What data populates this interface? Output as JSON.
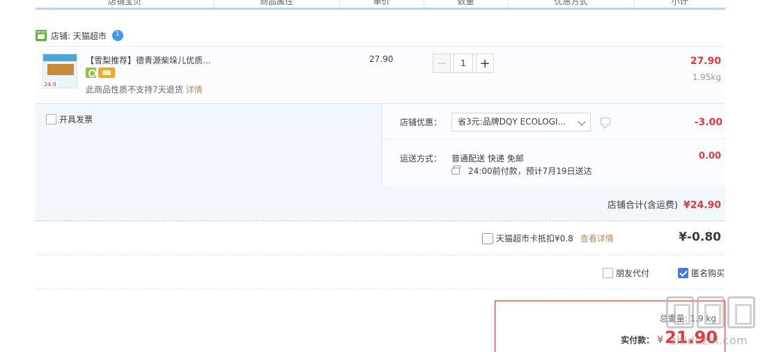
{
  "table_header": {
    "columns": [
      "店铺宝贝",
      "商品属性",
      "单价",
      "数量",
      "优惠方式",
      "小计"
    ]
  },
  "shop": {
    "label": "店铺: 天猫超市"
  },
  "item": {
    "title": "【雪梨推荐】德青源柴垛儿优质...",
    "thumb_tag": "24.9",
    "return_note": "此商品性质不支持7天退货",
    "detail_link": "详情",
    "unit_price": "27.90",
    "quantity": "1",
    "minus_symbol": "−",
    "plus_symbol": "+",
    "subtotal": "27.90",
    "weight": "1.95kg"
  },
  "options": {
    "invoice_label": "开具发票",
    "discount_label": "店铺优惠：",
    "discount_select": "省3元:品牌DQY ECOLOGI...",
    "discount_value": "-3.00",
    "shipping_label": "运送方式：",
    "shipping_method": "普通配送 快递 免邮",
    "shipping_eta": "24:00前付款，预计7月19日送达",
    "shipping_value": "0.00",
    "shop_total_label": "店铺合计(含运费)",
    "shop_total_value": "¥24.90"
  },
  "card": {
    "label": "天猫超市卡抵扣¥0.8",
    "link": "查看详情",
    "value": "¥-0.80"
  },
  "anon": {
    "friend_pay": "朋友代付",
    "anonymous": "匿名购买"
  },
  "pay": {
    "total_text": "总重量: 1.9 kg",
    "actual_label": "实付款：",
    "yen": "¥",
    "amount": "21.90"
  },
  "watermark": {
    "text": "zhidezhi.com"
  },
  "colors": {
    "accent_red": "#e4393c",
    "link_brown": "#b98b54",
    "header_blue": "#b2d1ff",
    "checkbox_blue": "#3d7bf0"
  }
}
